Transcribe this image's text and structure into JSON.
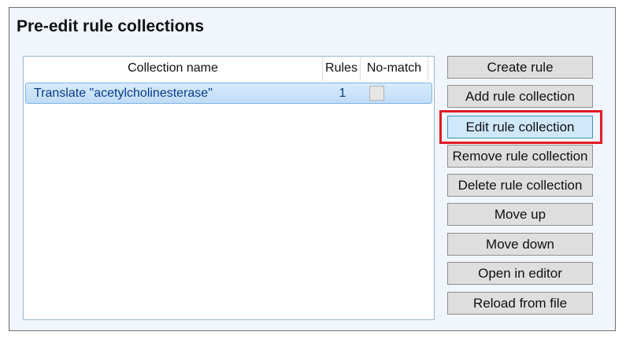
{
  "panel": {
    "title": "Pre-edit rule collections"
  },
  "list": {
    "columns": {
      "name": "Collection name",
      "rules": "Rules",
      "no_match": "No-match"
    },
    "rows": [
      {
        "name": "Translate \"acetylcholinesterase\"",
        "rules": "1",
        "no_match": false
      }
    ]
  },
  "buttons": {
    "create_rule": "Create rule",
    "add_rule_collection": "Add rule collection",
    "edit_rule_collection": "Edit rule collection",
    "remove_rule_collection": "Remove rule collection",
    "delete_rule_collection": "Delete rule collection",
    "move_up": "Move up",
    "move_down": "Move down",
    "open_in_editor": "Open in editor",
    "reload_from_file": "Reload from file"
  },
  "colors": {
    "highlight": "#e01b24",
    "selected_row": "#cce4f7",
    "panel_background": "#f0f6fc"
  }
}
